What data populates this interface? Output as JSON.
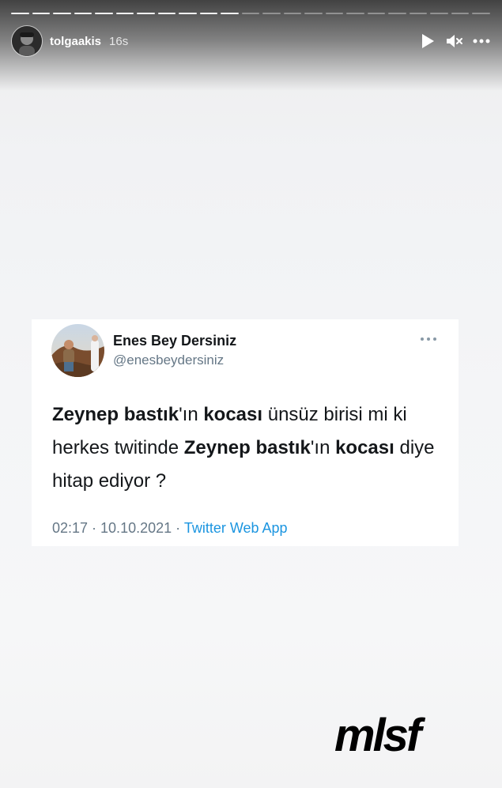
{
  "story": {
    "username": "tolgaakis",
    "time_ago": "16s",
    "progress": {
      "segments_total": 23,
      "segments_done": 11
    },
    "controls": {
      "play_icon": "play-icon",
      "mute_icon": "mute-icon",
      "more_icon": "more-icon"
    }
  },
  "tweet": {
    "display_name": "Enes Bey Dersiniz",
    "handle": "@enesbeydersiniz",
    "text_parts": [
      {
        "text": "Zeynep bastık",
        "bold": true
      },
      {
        "text": "'ın ",
        "bold": false
      },
      {
        "text": "kocası",
        "bold": true
      },
      {
        "text": " ünsüz birisi mi ki herkes twitinde ",
        "bold": false
      },
      {
        "text": "Zeynep bastık",
        "bold": true
      },
      {
        "text": "'ın ",
        "bold": false
      },
      {
        "text": "kocası",
        "bold": true
      },
      {
        "text": " diye hitap ediyor ?",
        "bold": false
      }
    ],
    "timestamp": "02:17 · 10.10.2021 · ",
    "source": "Twitter Web App"
  },
  "brand": {
    "logo_text": "mlsf"
  },
  "colors": {
    "tweet_link": "#1b95e0",
    "tweet_meta": "#657786",
    "tweet_text": "#14171a"
  }
}
